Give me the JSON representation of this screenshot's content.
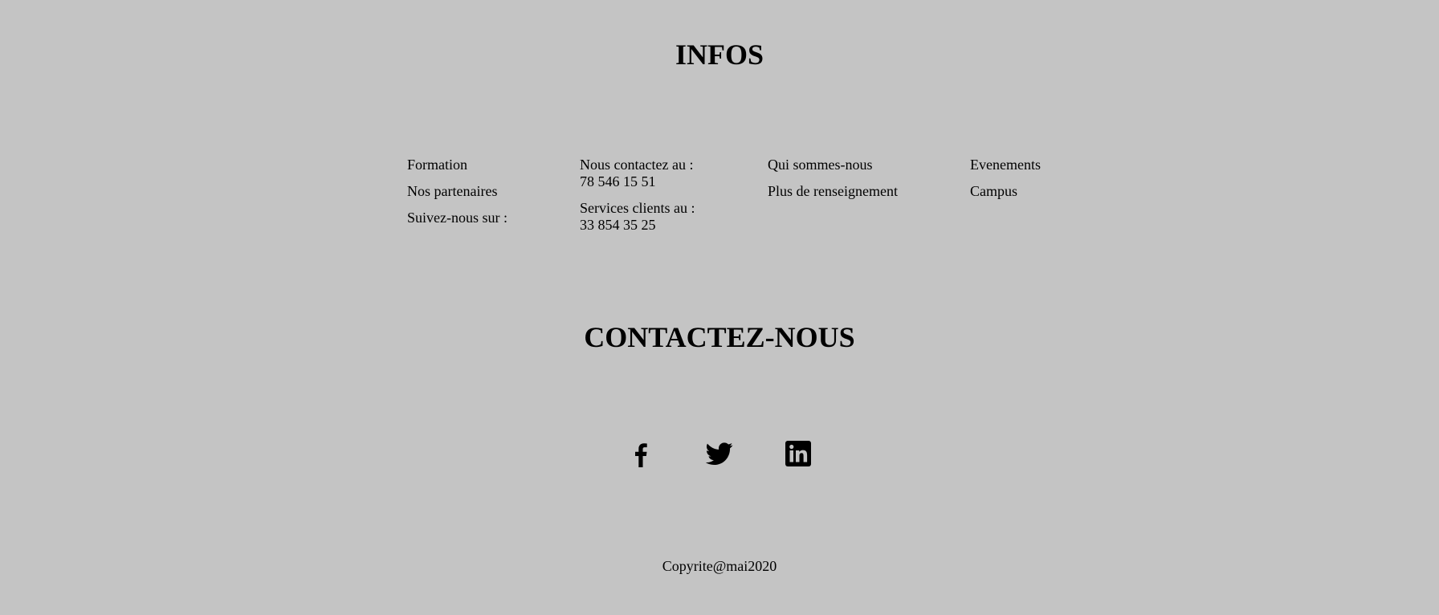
{
  "infos": {
    "title": "INFOS",
    "columns": [
      {
        "items": [
          "Formation",
          "Nos partenaires",
          "Suivez-nous sur :"
        ]
      },
      {
        "blocks": [
          {
            "label": "Nous contactez au :",
            "value": "78 546 15 51"
          },
          {
            "label": "Services clients au :",
            "value": "33 854 35 25"
          }
        ]
      },
      {
        "items": [
          "Qui sommes-nous",
          "Plus de renseignement"
        ]
      },
      {
        "items": [
          "Evenements",
          "Campus"
        ]
      }
    ]
  },
  "contact": {
    "title": "CONTACTEZ-NOUS",
    "socials": [
      {
        "icon": "facebook-icon"
      },
      {
        "icon": "twitter-icon"
      },
      {
        "icon": "linkedin-icon"
      }
    ]
  },
  "footer": {
    "copyright": "Copyrite@mai2020"
  },
  "colors": {
    "background": "#c4c4c4",
    "text": "#000000"
  }
}
